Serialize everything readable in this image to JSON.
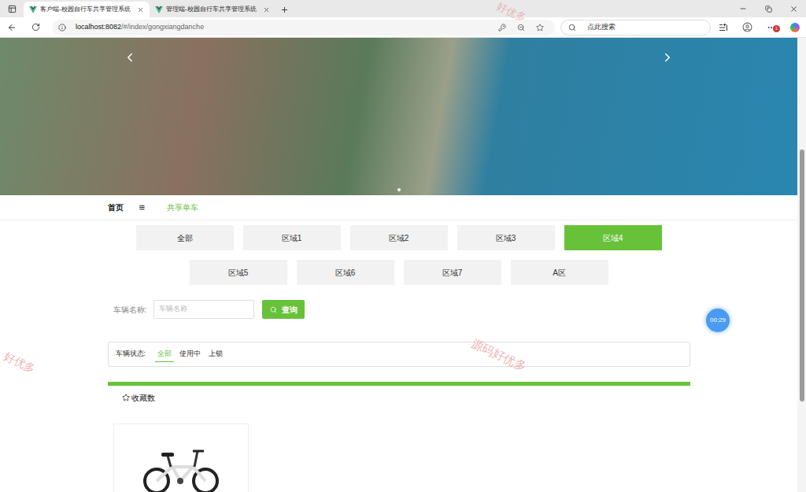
{
  "browser": {
    "tabs": [
      {
        "title": "客户端-校园自行车共享管理系统",
        "selected": true
      },
      {
        "title": "管理端-校园自行车共享管理系统",
        "selected": false
      }
    ],
    "url": {
      "host": "localhost:8082",
      "path": "/#/index/gongxiangdanche"
    },
    "search_placeholder": "点此搜索",
    "notification_count": "1"
  },
  "carousel": {
    "dots": [
      {
        "selected": true
      }
    ]
  },
  "nav": {
    "items": [
      {
        "label": "首页",
        "selected": false,
        "kind": "home"
      },
      {
        "label": "≡",
        "selected": false,
        "kind": "menu"
      },
      {
        "label": "共享单车",
        "selected": true,
        "kind": "link"
      }
    ]
  },
  "regions": [
    {
      "label": "全部",
      "selected": false
    },
    {
      "label": "区域1",
      "selected": false
    },
    {
      "label": "区域2",
      "selected": false
    },
    {
      "label": "区域3",
      "selected": false
    },
    {
      "label": "区域4",
      "selected": true
    },
    {
      "label": "区域5",
      "selected": false
    },
    {
      "label": "区域6",
      "selected": false
    },
    {
      "label": "区域7",
      "selected": false
    },
    {
      "label": "A区",
      "selected": false
    }
  ],
  "search": {
    "label": "车辆名称:",
    "placeholder": "车辆名称",
    "button": "查询"
  },
  "status_filter": {
    "label": "车辆状态:",
    "options": [
      {
        "label": "全部",
        "selected": true
      },
      {
        "label": "使用中",
        "selected": false
      },
      {
        "label": "上锁",
        "selected": false
      }
    ]
  },
  "sort": {
    "label": "收藏数"
  },
  "timer": "00:29",
  "watermarks": [
    "源码好优多",
    "好优多",
    "好优多"
  ]
}
